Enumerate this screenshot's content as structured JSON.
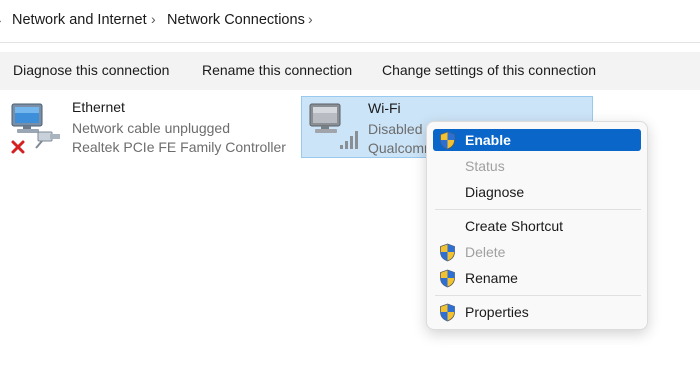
{
  "breadcrumb": {
    "lead": "›",
    "items": [
      "Network and Internet",
      "Network Connections"
    ],
    "separator": "›"
  },
  "toolbar": {
    "diagnose": "Diagnose this connection",
    "rename": "Rename this connection",
    "change_settings": "Change settings of this connection"
  },
  "connections": [
    {
      "name": "Ethernet",
      "status": "Network cable unplugged",
      "device": "Realtek PCIe FE Family Controller",
      "icon": "ethernet-disconnected-icon"
    },
    {
      "name": "Wi-Fi",
      "status": "Disabled",
      "device": "Qualcomm",
      "icon": "wifi-adapter-icon"
    }
  ],
  "context_menu": {
    "items": [
      {
        "label": "Enable",
        "shield": true,
        "state": "highlighted"
      },
      {
        "label": "Status",
        "shield": false,
        "state": "disabled"
      },
      {
        "label": "Diagnose",
        "shield": false,
        "state": "normal"
      },
      {
        "label": "Create Shortcut",
        "shield": false,
        "state": "normal"
      },
      {
        "label": "Delete",
        "shield": true,
        "state": "disabled"
      },
      {
        "label": "Rename",
        "shield": true,
        "state": "normal"
      },
      {
        "label": "Properties",
        "shield": true,
        "state": "normal"
      }
    ]
  },
  "colors": {
    "selection_bg": "#cce4f7",
    "menu_highlight": "#0a67c9",
    "toolbar_bg": "#f3f3f3"
  }
}
